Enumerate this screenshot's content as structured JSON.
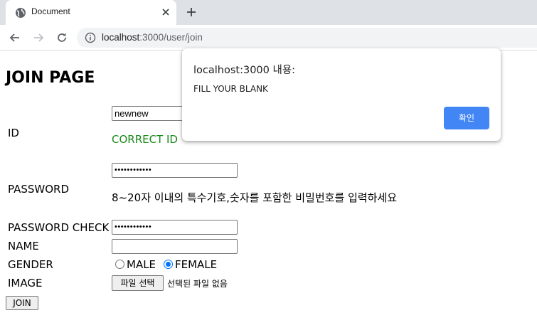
{
  "browser": {
    "tab_title": "Document",
    "url_host": "localhost",
    "url_rest": ":3000/user/join"
  },
  "page": {
    "title": "JOIN PAGE",
    "labels": {
      "id": "ID",
      "password": "PASSWORD",
      "password_check": "PASSWORD CHECK",
      "name": "NAME",
      "gender": "GENDER",
      "image": "IMAGE"
    },
    "fields": {
      "id_value": "newnew",
      "password_value": "••••••••••••",
      "password_check_value": "••••••••••••",
      "name_value": ""
    },
    "id_message": "CORRECT ID",
    "id_message_color": "#1a8a1a",
    "password_hint": "8~20자 이내의 특수기호,숫자를 포함한 비밀번호를 입력하세요",
    "gender_options": {
      "male": "MALE",
      "female": "FEMALE",
      "selected": "FEMALE"
    },
    "file_button": "파일 선택",
    "file_status": "선택된 파일 없음",
    "join_button": "JOIN"
  },
  "dialog": {
    "title": "localhost:3000 내용:",
    "message": "FILL YOUR BLANK",
    "ok_label": "확인",
    "ok_color": "#4285f4"
  }
}
